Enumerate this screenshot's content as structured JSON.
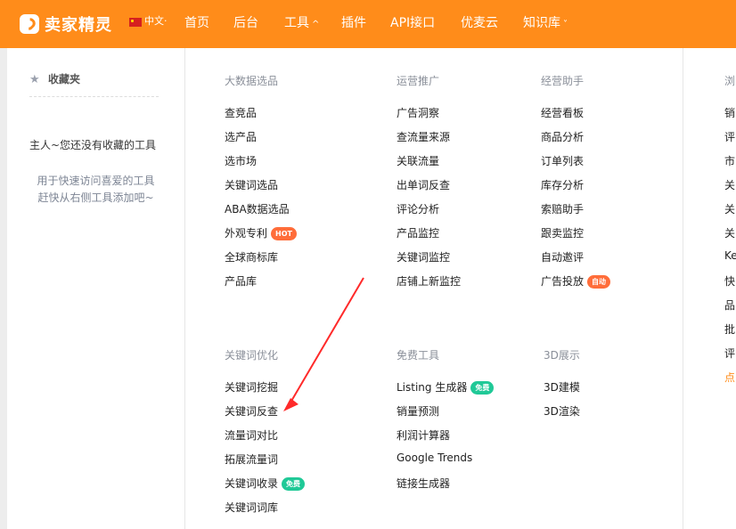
{
  "header": {
    "logo_text": "卖家精灵",
    "lang": "中文·",
    "nav": [
      {
        "label": "首页"
      },
      {
        "label": "后台"
      },
      {
        "label": "工具",
        "caret": "^"
      },
      {
        "label": "插件"
      },
      {
        "label": "API接口"
      },
      {
        "label": "优麦云"
      },
      {
        "label": "知识库",
        "caret": "˅"
      }
    ]
  },
  "sidebar": {
    "title": "收藏夹",
    "empty_message": "主人~您还没有收藏的工具",
    "hint_line1": "用于快速访问喜爱的工具",
    "hint_line2": "赶快从右侧工具添加吧~"
  },
  "sections": [
    {
      "title": "大数据选品",
      "items": [
        "查竞品",
        "选产品",
        "选市场",
        "关键词选品",
        "ABA数据选品",
        "外观专利",
        "全球商标库",
        "产品库"
      ],
      "badges": {
        "5": "HOT"
      }
    },
    {
      "title": "运营推广",
      "items": [
        "广告洞察",
        "查流量来源",
        "关联流量",
        "出单词反查",
        "评论分析",
        "产品监控",
        "关键词监控",
        "店铺上新监控"
      ]
    },
    {
      "title": "经营助手",
      "items": [
        "经营看板",
        "商品分析",
        "订单列表",
        "库存分析",
        "索赔助手",
        "跟卖监控",
        "自动邀评",
        "广告投放"
      ],
      "badges": {
        "7": "自动"
      }
    },
    {
      "title": "关键词优化",
      "items": [
        "关键词挖掘",
        "关键词反查",
        "流量词对比",
        "拓展流量词",
        "关键词收录",
        "关键词词库"
      ],
      "badges": {
        "4": "免费"
      }
    },
    {
      "title": "免费工具",
      "items": [
        "Listing 生成器",
        "销量预测",
        "利润计算器",
        "Google Trends",
        "链接生成器"
      ],
      "badges": {
        "0": "免费"
      }
    },
    {
      "title": "3D展示",
      "items": [
        "3D建模",
        "3D渲染"
      ]
    }
  ],
  "right_partial": {
    "title": "浏",
    "items": [
      "销",
      "评",
      "市",
      "关",
      "关",
      "关",
      "Ke",
      "快",
      "品",
      "批",
      "评",
      "点"
    ]
  },
  "colors": {
    "brand": "#ff8c1a",
    "annotation": "#ff2a2a"
  }
}
